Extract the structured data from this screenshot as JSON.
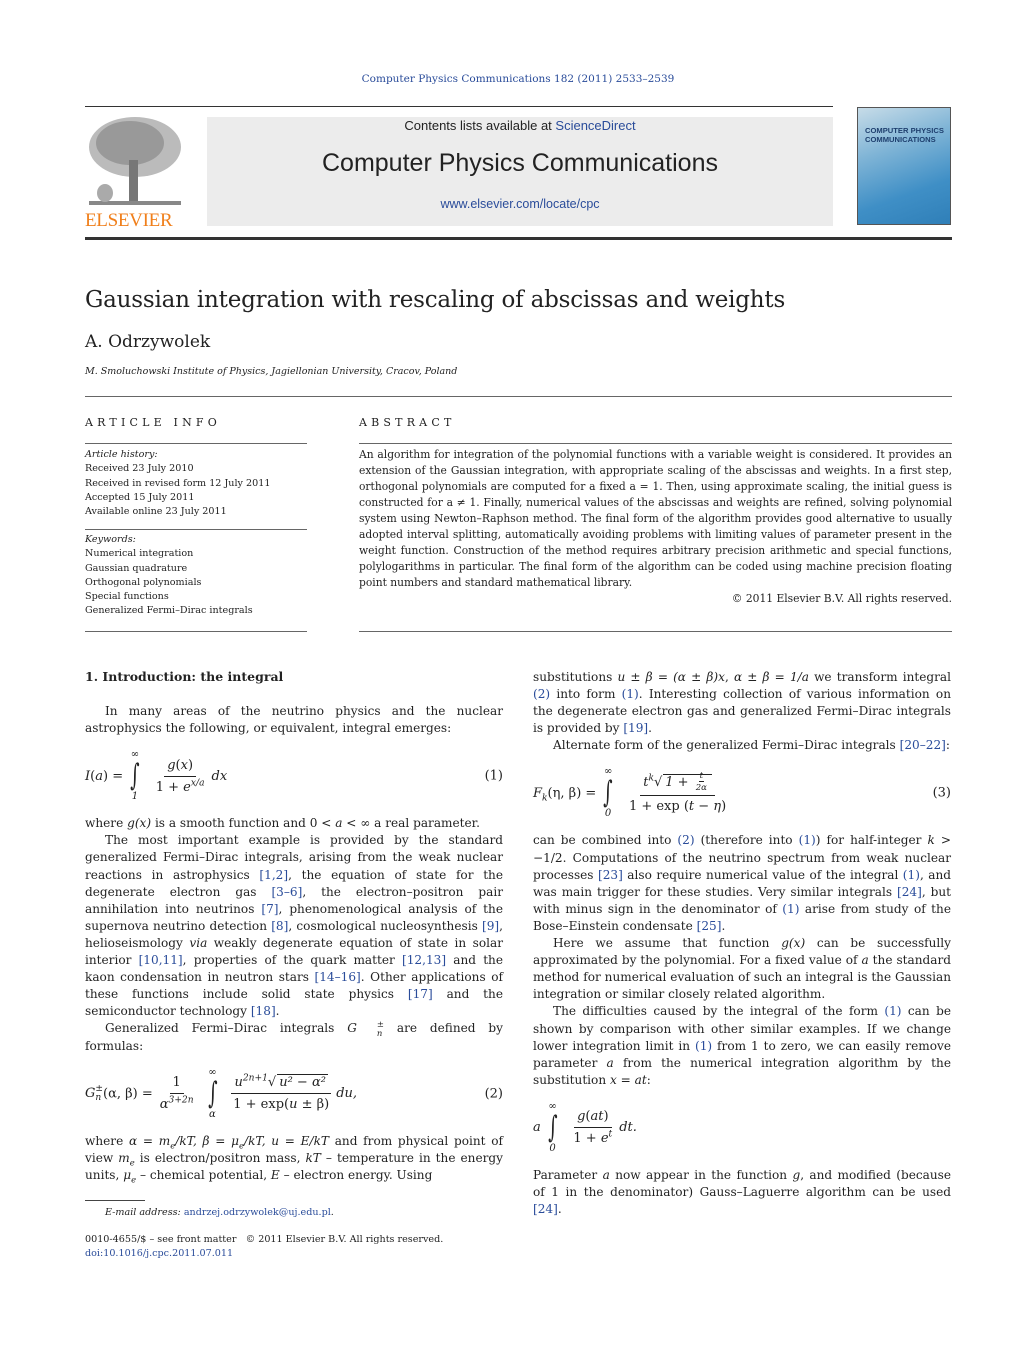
{
  "header": {
    "journal_ref": "Computer Physics Communications 182 (2011) 2533–2539",
    "contents_prefix": "Contents lists available at ",
    "contents_link": "ScienceDirect",
    "journal_title": "Computer Physics Communications",
    "journal_url": "www.elsevier.com/locate/cpc",
    "publisher_logo": "ELSEVIER",
    "cover_title": "COMPUTER PHYSICS COMMUNICATIONS"
  },
  "colors": {
    "link": "#2a4c9a",
    "publisher": "#f07f1b",
    "cover": "#3f8fc6"
  },
  "article": {
    "title": "Gaussian integration with rescaling of abscissas and weights",
    "author": "A. Odrzywolek",
    "affiliation": "M. Smoluchowski Institute of Physics, Jagiellonian University, Cracov, Poland"
  },
  "article_info": {
    "heading": "ARTICLE INFO",
    "history_label": "Article history:",
    "history": [
      "Received 23 July 2010",
      "Received in revised form 12 July 2011",
      "Accepted 15 July 2011",
      "Available online 23 July 2011"
    ],
    "keywords_label": "Keywords:",
    "keywords": [
      "Numerical integration",
      "Gaussian quadrature",
      "Orthogonal polynomials",
      "Special functions",
      "Generalized Fermi–Dirac integrals"
    ]
  },
  "abstract": {
    "heading": "ABSTRACT",
    "text": "An algorithm for integration of the polynomial functions with a variable weight is considered. It provides an extension of the Gaussian integration, with appropriate scaling of the abscissas and weights. In a first step, orthogonal polynomials are computed for a fixed a = 1. Then, using approximate scaling, the initial guess is constructed for a ≠ 1. Finally, numerical values of the abscissas and weights are refined, solving polynomial system using Newton–Raphson method. The final form of the algorithm provides good alternative to usually adopted interval splitting, automatically avoiding problems with limiting values of parameter present in the weight function. Construction of the method requires arbitrary precision arithmetic and special functions, polylogarithms in particular. The final form of the algorithm can be coded using machine precision floating point numbers and standard mathematical library.",
    "copyright": "© 2011 Elsevier B.V. All rights reserved."
  },
  "section": {
    "heading": "1.  Introduction: the integral"
  },
  "left_blocks": [
    {
      "type": "p",
      "indent": true,
      "segs": [
        "In many areas of the neutrino physics and the nuclear astrophysics the following, or equivalent, integral emerges:"
      ]
    },
    {
      "type": "eq",
      "lhs": [
        {
          "t": "I",
          "i": true
        },
        {
          "t": "("
        },
        {
          "t": "a",
          "i": true
        },
        {
          "t": ") ="
        }
      ],
      "upper": "∞",
      "lower": "1",
      "num": [
        {
          "t": "g",
          "i": true
        },
        {
          "t": "("
        },
        {
          "t": "x",
          "i": true
        },
        {
          "t": ")"
        }
      ],
      "den": [
        {
          "t": "1 + "
        },
        {
          "t": "e",
          "i": true,
          "sup": "x/a"
        }
      ],
      "trail": "dx",
      "number": "(1)"
    },
    {
      "type": "p",
      "indent": false,
      "segs": [
        "where ",
        {
          "t": "g(x)",
          "i": true
        },
        " is a smooth function and 0 < ",
        {
          "t": "a",
          "i": true
        },
        " < ∞ a real parameter."
      ]
    },
    {
      "type": "p",
      "indent": true,
      "segs": [
        "The most important example is provided by the standard generalized Fermi–Dirac integrals, arising from the weak nuclear reactions in astrophysics ",
        {
          "ref": "[1,2]"
        },
        ", the equation of state for the degenerate electron gas ",
        {
          "ref": "[3–6]"
        },
        ", the electron–positron pair annihilation into neutrinos ",
        {
          "ref": "[7]"
        },
        ", phenomenological analysis of the supernova neutrino detection ",
        {
          "ref": "[8]"
        },
        ", cosmological nucleosynthesis ",
        {
          "ref": "[9]"
        },
        ", helioseismology ",
        {
          "t": "via",
          "i": true
        },
        " weakly degenerate equation of state in solar interior ",
        {
          "ref": "[10,11]"
        },
        ", properties of the quark matter ",
        {
          "ref": "[12,13]"
        },
        " and the kaon condensation in neutron stars ",
        {
          "ref": "[14–16]"
        },
        ". Other applications of these functions include solid state physics ",
        {
          "ref": "[17]"
        },
        " and the semiconductor technology ",
        {
          "ref": "[18]"
        },
        "."
      ]
    },
    {
      "type": "p",
      "indent": true,
      "segs": [
        "Generalized Fermi–Dirac integrals ",
        {
          "t": "G",
          "i": true,
          "sup": "±",
          "sub": "n"
        },
        " are defined by formulas:"
      ]
    },
    {
      "type": "eq",
      "lhs": [
        {
          "t": "G",
          "i": true,
          "sup": "±",
          "sub": "n"
        },
        {
          "t": "(α, β) ="
        }
      ],
      "pre_num": "1",
      "pre_den": [
        {
          "t": "α",
          "i": true,
          "sup": "3+2n"
        }
      ],
      "upper": "∞",
      "lower": "α",
      "num": [
        {
          "t": "u",
          "i": true,
          "sup": "2n+1"
        },
        {
          "sqrt": "u² − α²"
        }
      ],
      "den": [
        {
          "t": "1 + exp("
        },
        {
          "t": "u",
          "i": true
        },
        {
          "t": " ± β)"
        }
      ],
      "trail": "du,",
      "number": "(2)"
    },
    {
      "type": "p",
      "indent": false,
      "segs": [
        "where ",
        {
          "t": "α = m",
          "i": true,
          "sub": "e"
        },
        {
          "t": "/kT, β = μ",
          "i": true,
          "sub": "e"
        },
        {
          "t": "/kT, u = E/kT",
          "i": true
        },
        " and from physical point of view ",
        {
          "t": "m",
          "i": true,
          "sub": "e"
        },
        " is electron/positron mass, ",
        {
          "t": "kT",
          "i": true
        },
        " – temperature in the energy units, ",
        {
          "t": "μ",
          "i": true,
          "sub": "e"
        },
        " – chemical potential, ",
        {
          "t": "E",
          "i": true
        },
        " – electron energy. Using"
      ]
    }
  ],
  "right_blocks": [
    {
      "type": "p",
      "indent": false,
      "segs": [
        "substitutions ",
        {
          "t": "u ± β = (α ± β)x",
          "i": true
        },
        ", ",
        {
          "t": "α ± β = 1/a",
          "i": true
        },
        " we transform integral ",
        {
          "ref": "(2)"
        },
        " into form ",
        {
          "ref": "(1)"
        },
        ". Interesting collection of various information on the degenerate electron gas and generalized Fermi–Dirac integrals is provided by ",
        {
          "ref": "[19]"
        },
        "."
      ]
    },
    {
      "type": "p",
      "indent": true,
      "segs": [
        "Alternate form of the generalized Fermi–Dirac integrals ",
        {
          "ref": "[20–22]"
        },
        ":"
      ]
    },
    {
      "type": "eq",
      "lhs": [
        {
          "t": "F",
          "i": true,
          "sub": "k"
        },
        {
          "t": "(η, β) ="
        }
      ],
      "upper": "∞",
      "lower": "0",
      "num": [
        {
          "t": "t",
          "i": true,
          "sup": "k"
        },
        {
          "sqrt": "1 + ",
          "fn": "t",
          "fd": "2α"
        }
      ],
      "den": [
        {
          "t": "1 + exp ("
        },
        {
          "t": "t − η",
          "i": true
        },
        {
          "t": ")"
        }
      ],
      "trail": "",
      "number": "(3)"
    },
    {
      "type": "p",
      "indent": false,
      "segs": [
        "can be combined into ",
        {
          "ref": "(2)"
        },
        " (therefore into ",
        {
          "ref": "(1)"
        },
        ") for half-integer ",
        {
          "t": "k",
          "i": true
        },
        " > −1/2. Computations of the neutrino spectrum from weak nuclear processes ",
        {
          "ref": "[23]"
        },
        " also require numerical value of the integral ",
        {
          "ref": "(1)"
        },
        ", and was main trigger for these studies. Very similar integrals ",
        {
          "ref": "[24]"
        },
        ", but with minus sign in the denominator of ",
        {
          "ref": "(1)"
        },
        " arise from study of the Bose–Einstein condensate ",
        {
          "ref": "[25]"
        },
        "."
      ]
    },
    {
      "type": "p",
      "indent": true,
      "segs": [
        "Here we assume that function ",
        {
          "t": "g(x)",
          "i": true
        },
        " can be successfully approximated by the polynomial. For a fixed value of ",
        {
          "t": "a",
          "i": true
        },
        " the standard method for numerical evaluation of such an integral is the Gaussian integration or similar closely related algorithm."
      ]
    },
    {
      "type": "p",
      "indent": true,
      "segs": [
        "The difficulties caused by the integral of the form ",
        {
          "ref": "(1)"
        },
        " can be shown by comparison with other similar examples. If we change lower integration limit in ",
        {
          "ref": "(1)"
        },
        " from 1 to zero, we can easily remove parameter ",
        {
          "t": "a",
          "i": true
        },
        " from the numerical integration algorithm by the substitution ",
        {
          "t": "x = at",
          "i": true
        },
        ":"
      ]
    },
    {
      "type": "eq",
      "lhs": [
        {
          "t": "a",
          "i": true
        }
      ],
      "upper": "∞",
      "lower": "0",
      "num": [
        {
          "t": "g",
          "i": true
        },
        {
          "t": "("
        },
        {
          "t": "at",
          "i": true
        },
        {
          "t": ")"
        }
      ],
      "den": [
        {
          "t": "1 + "
        },
        {
          "t": "e",
          "i": true,
          "sup": "t"
        }
      ],
      "trail": "dt.",
      "number": ""
    },
    {
      "type": "p",
      "indent": false,
      "segs": [
        "Parameter ",
        {
          "t": "a",
          "i": true
        },
        " now appear in the function ",
        {
          "t": "g",
          "i": true
        },
        ", and modified (because of 1 in the denominator) Gauss–Laguerre algorithm can be used ",
        {
          "ref": "[24]"
        },
        "."
      ]
    }
  ],
  "footer": {
    "email_label": "E-mail address: ",
    "email": "andrzej.odrzywolek@uj.edu.pl",
    "email_end": ".",
    "front_matter": "0010-4655/$ – see front matter   © 2011 Elsevier B.V. All rights reserved.",
    "doi": "doi:10.1016/j.cpc.2011.07.011"
  }
}
